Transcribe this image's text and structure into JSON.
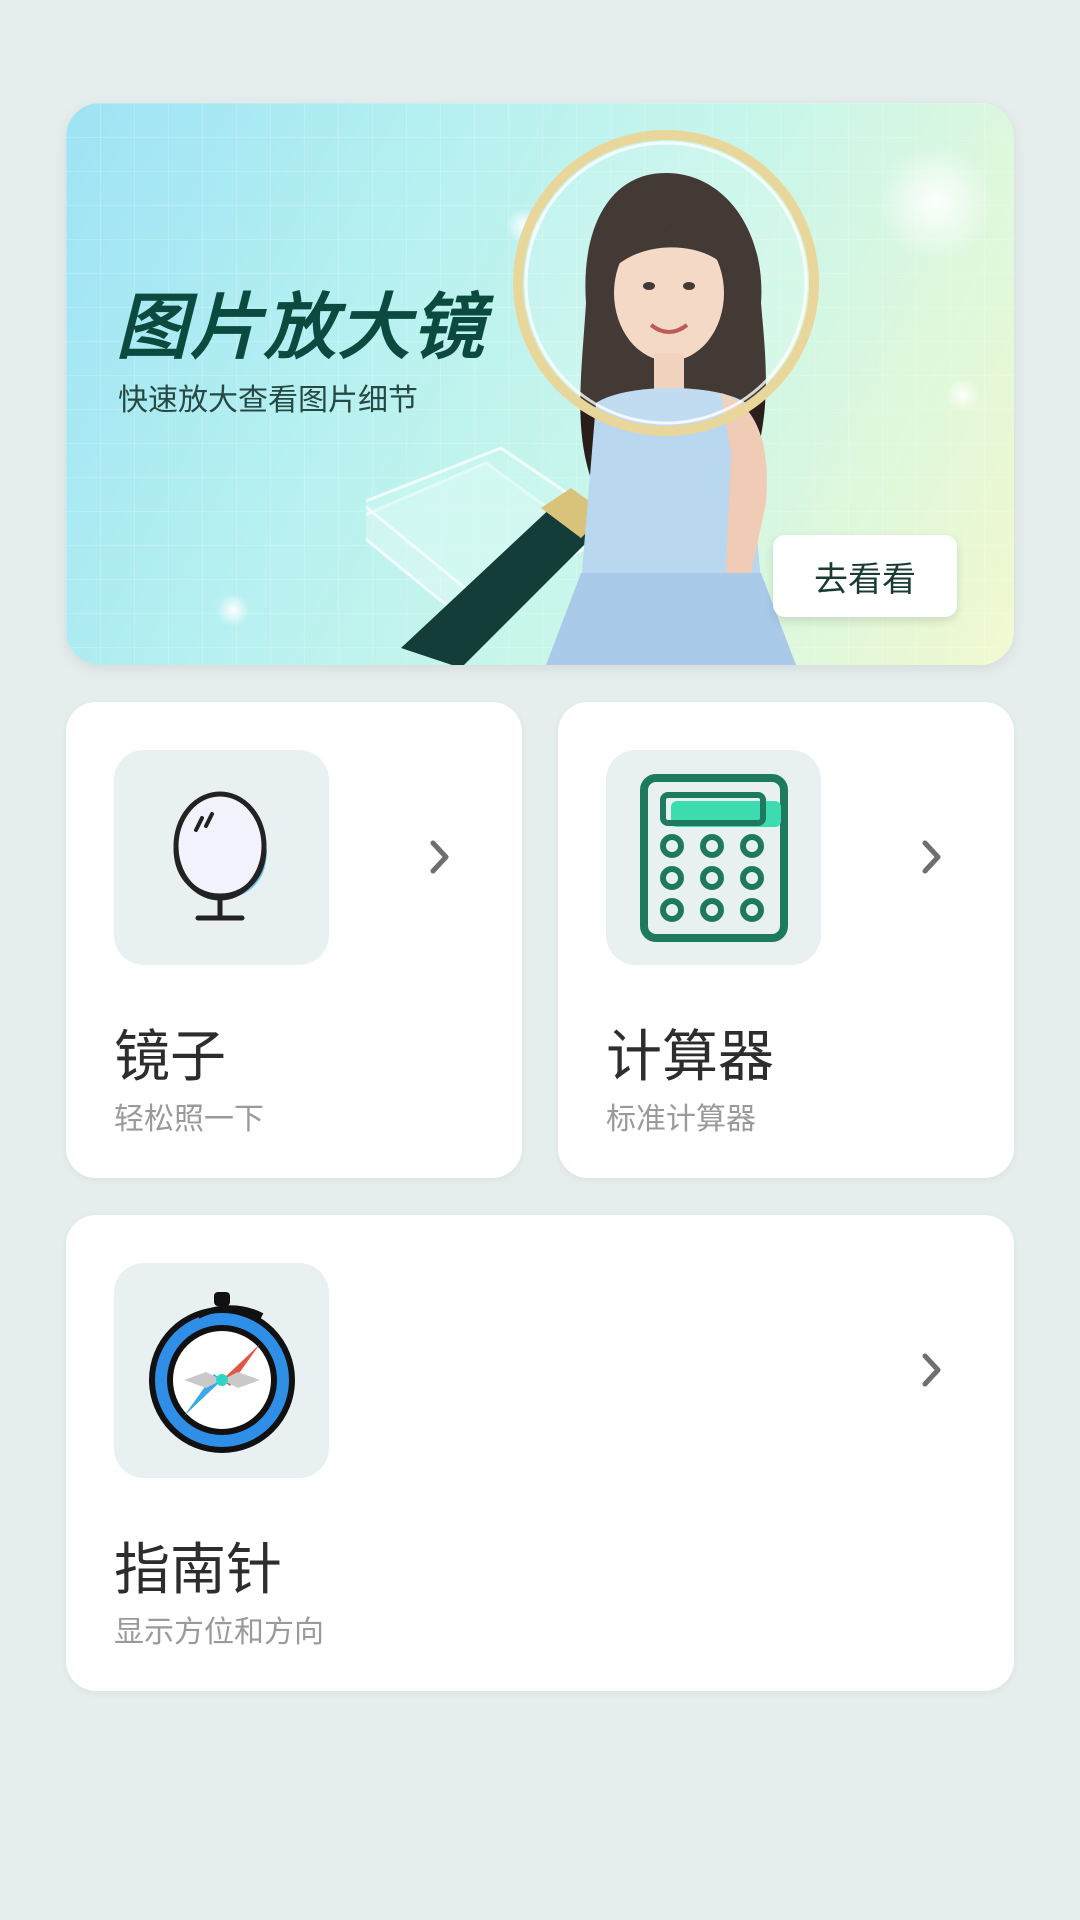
{
  "banner": {
    "title": "图片放大镜",
    "subtitle": "快速放大查看图片细节",
    "button_label": "去看看"
  },
  "tools": [
    {
      "title": "镜子",
      "subtitle": "轻松照一下",
      "icon": "mirror-icon"
    },
    {
      "title": "计算器",
      "subtitle": "标准计算器",
      "icon": "calculator-icon"
    },
    {
      "title": "指南针",
      "subtitle": "显示方位和方向",
      "icon": "compass-icon"
    }
  ],
  "colors": {
    "background": "#e5eeed",
    "banner_title": "#0c4a3f",
    "calculator_accent": "#1e7a5e",
    "compass_ring": "#2f8ee6"
  }
}
